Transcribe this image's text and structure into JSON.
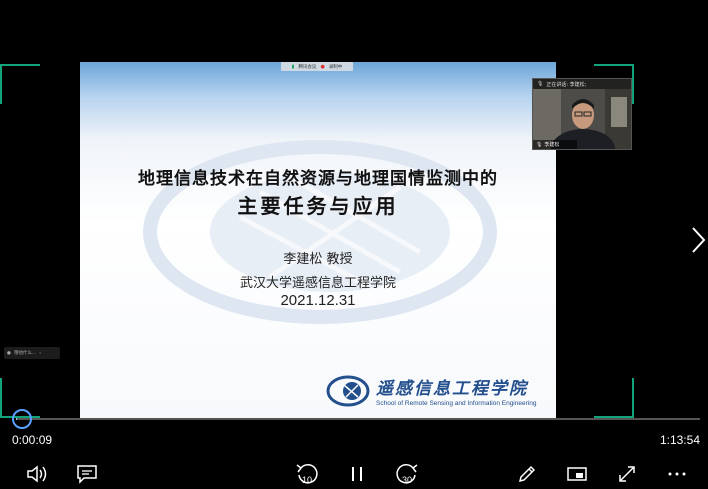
{
  "meeting_bar": {
    "app_name": "腾讯会议",
    "recording": "录制中"
  },
  "slide": {
    "title_line1": "地理信息技术在自然资源与地理国情监测中的",
    "title_line2": "主要任务与应用",
    "author": "李建松 教授",
    "institute": "武汉大学遥感信息工程学院",
    "date": "2021.12.31",
    "school_name_cn": "遥感信息工程学院",
    "school_name_en": "School of Remote Sensing and Information Engineering"
  },
  "camera": {
    "speaking_label": "正在讲话: 李建松;",
    "participant_name": "李建松"
  },
  "side_chat": {
    "text": "哦他什么..."
  },
  "player": {
    "current_time": "0:00:09",
    "duration": "1:13:54",
    "progress_fraction": 0.002,
    "skip_back": "10",
    "skip_forward": "30"
  },
  "colors": {
    "accent": "#12a37a",
    "progress": "#5aa0ff",
    "logo_blue": "#234f8d"
  }
}
